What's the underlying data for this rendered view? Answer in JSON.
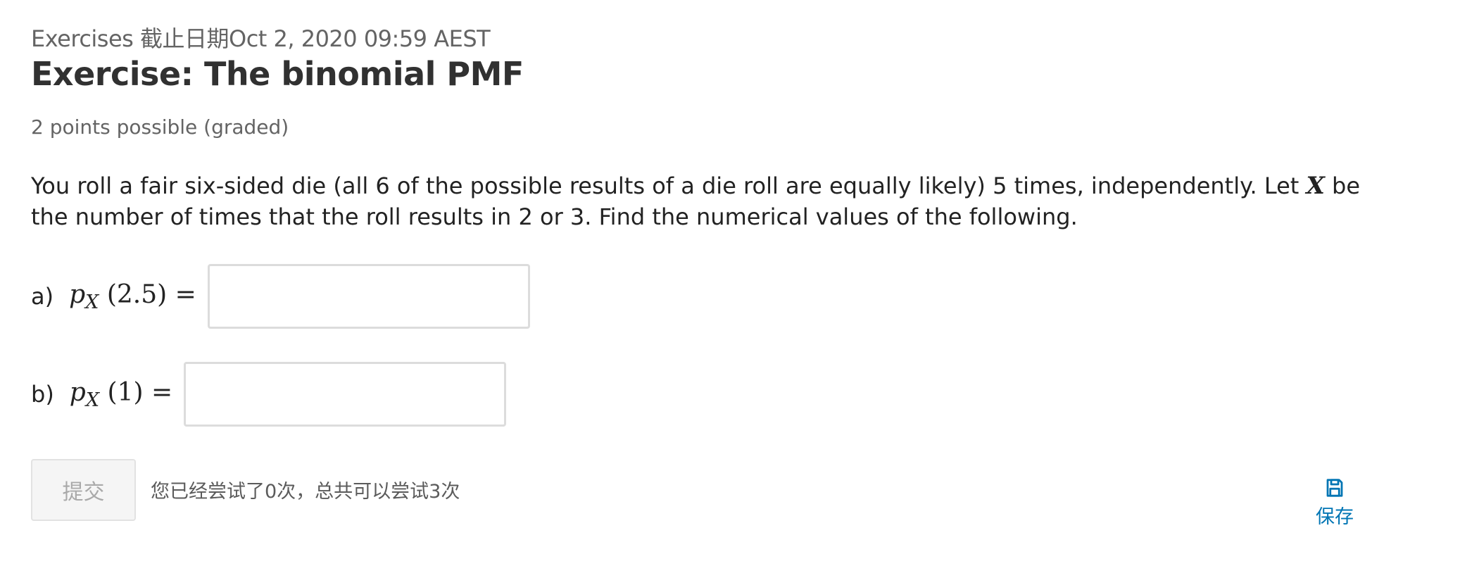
{
  "header": {
    "subsection": "Exercises 截止日期Oct 2, 2020 09:59 AEST",
    "title": "Exercise: The binomial PMF",
    "points": "2 points possible (graded)"
  },
  "problem": {
    "text_before": "You roll a fair six-sided die (all 6 of the possible results of a die roll are equally likely) 5 times, independently. Let ",
    "var": "X",
    "text_after": " be the number of times that the roll results in 2 or 3. Find the numerical values of the following."
  },
  "questions": [
    {
      "label": "a)",
      "func": "p",
      "sub": "X",
      "arg": " (2.5) =",
      "value": ""
    },
    {
      "label": "b)",
      "func": "p",
      "sub": "X",
      "arg": " (1) =",
      "value": ""
    }
  ],
  "actions": {
    "submit_label": "提交",
    "attempts_text": "您已经尝试了0次，总共可以尝试3次",
    "save_label": "保存",
    "save_icon": "floppy-disk-icon",
    "link_color": "#0075b4"
  }
}
